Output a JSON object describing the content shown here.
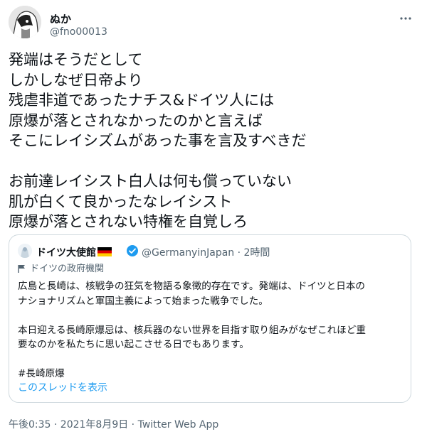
{
  "tweet": {
    "author_name": "ぬか",
    "author_handle": "@fno00013",
    "text_lines": [
      "発端はそうだとして",
      "しかしなぜ日帝より",
      "残虐非道であったナチス&ドイツ人には",
      "原爆が落とされなかったのかと言えば",
      "そこにレイシズムがあった事を言及すべきだ",
      "",
      "お前達レイシスト白人は何も償っていない",
      "肌が白くて良かったなレイシスト",
      "原爆が落とされない特権を自覚しろ"
    ],
    "meta": "午後0:35 · 2021年8月9日 · Twitter Web App"
  },
  "quote": {
    "author_name": "ドイツ大使館",
    "author_handle": "@GermanyinJapan · 2時間",
    "label": "ドイツの政府機関",
    "text_lines": [
      "広島と長崎は、核戦争の狂気を物語る象徴的存在です。発端は、ドイツと日本の",
      "ナショナリズムと軍国主義によって始まった戦争でした。",
      "",
      "本日迎える長崎原爆忌は、核兵器のない世界を目指す取り組みがなぜこれほど重",
      "要なのかを私たちに思い起こさせる日でもあります。",
      "",
      "#長崎原爆"
    ],
    "thread_link": "このスレッドを表示"
  },
  "icons": {
    "more": "more-options-icon",
    "verified": "verified-badge-icon",
    "flag": "german-flag-icon",
    "label_flag": "flag-icon"
  },
  "colors": {
    "text": "#0f1419",
    "secondary": "#536471",
    "link": "#1d9bf0",
    "border": "#cfd9de"
  }
}
